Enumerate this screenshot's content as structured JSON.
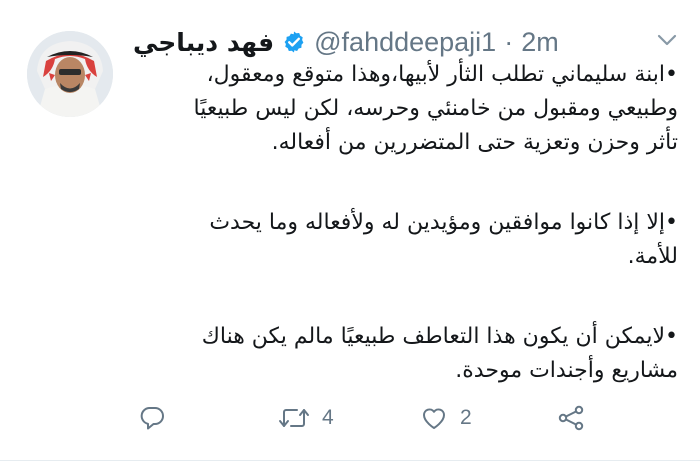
{
  "user": {
    "display_name": "فهد ديباجي",
    "handle": "@fahddeepaji1",
    "separator": "·",
    "time": "2m",
    "verified": true
  },
  "tweet": {
    "paragraphs": [
      {
        "lines": [
          "•ابنة سليماني تطلب الثأر لأبيها،وهذا متوقع ومعقول،",
          "وطبيعي ومقبول من خامنئي وحرسه، لكن ليس طبيعيًا",
          "تأثر وحزن وتعزية حتى المتضررين من أفعاله."
        ]
      },
      {
        "lines": [
          "•إلا إذا كانوا موافقين ومؤيدين له ولأفعاله وما يحدث",
          "للأمة."
        ]
      },
      {
        "lines": [
          "•لايمكن أن يكون هذا التعاطف طبيعيًا مالم يكن هناك",
          "مشاريع وأجندات موحدة."
        ]
      }
    ]
  },
  "actions": {
    "reply_count": "",
    "retweet_count": "4",
    "like_count": "2"
  },
  "colors": {
    "text": "#14171a",
    "secondary": "#657786",
    "verified": "#1da1f2"
  },
  "icons": [
    "verified-badge-icon",
    "chevron-down-icon",
    "reply-icon",
    "retweet-icon",
    "like-icon",
    "share-icon"
  ]
}
